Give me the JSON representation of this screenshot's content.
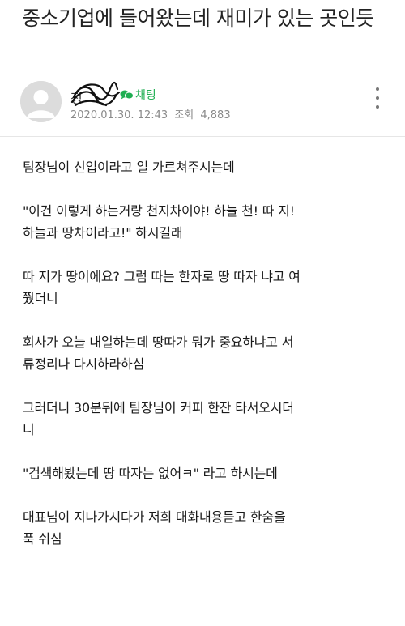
{
  "post": {
    "title": "중소기업에 들어왔는데 재미가 있는 곳인듯",
    "author": "정",
    "chat_label": "채팅",
    "date": "2020.01.30. 12:43",
    "views_label": "조회",
    "views": "4,883"
  },
  "body": {
    "paragraphs": [
      "팀장님이 신입이라고 일 가르쳐주시는데",
      "\"이건 이렇게 하는거랑 천지차이야! 하늘 천! 따 지!\n하늘과 땅차이라고!\" 하시길래",
      "따 지가 땅이에요? 그럼 따는 한자로 땅 따자 냐고 여\n쭸더니",
      "회사가 오늘 내일하는데 땅따가 뭐가 중요하냐고 서\n류정리나 다시하라하심",
      "그러더니 30분뒤에 팀장님이 커피 한잔 타서오시더\n니",
      "\"검색해봤는데 땅 따자는 없어ㅋ\" 라고 하시는데",
      "대표님이 지나가시다가 저희 대화내용듣고 한숨을\n푹 쉬심"
    ]
  },
  "colors": {
    "chat_green": "#1fae52",
    "meta_gray": "#8a8a8a"
  },
  "icons": [
    "avatar-placeholder-icon",
    "chat-bubble-icon",
    "more-vertical-icon"
  ]
}
